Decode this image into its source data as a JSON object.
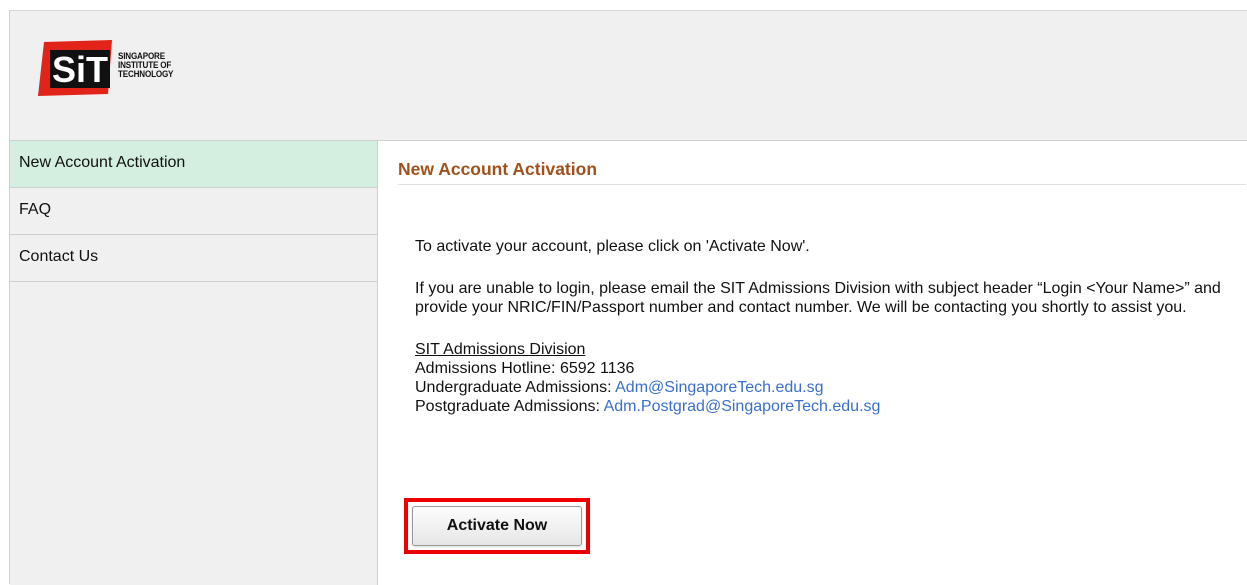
{
  "header": {
    "logo_alt": "SIT Singapore Institute of Technology",
    "logo_mark_text": "SiT",
    "logo_text_lines": [
      "SINGAPORE",
      "INSTITUTE OF",
      "TECHNOLOGY"
    ]
  },
  "sidebar": {
    "items": [
      {
        "label": "New Account Activation",
        "active": true
      },
      {
        "label": "FAQ",
        "active": false
      },
      {
        "label": "Contact Us",
        "active": false
      }
    ]
  },
  "main": {
    "title": "New Account Activation",
    "instruction": "To activate your account, please click on 'Activate Now'.",
    "help_text": "If you are unable to login, please email the SIT Admissions Division with subject header “Login <Your Name>” and provide your NRIC/FIN/Passport number and contact number. We will be contacting you shortly to assist you.",
    "contact": {
      "title": "SIT Admissions Division",
      "hotline_label": "Admissions Hotline: 6592 1136",
      "undergrad_label": "Undergraduate Admissions: ",
      "undergrad_email": "Adm@SingaporeTech.edu.sg",
      "postgrad_label": "Postgraduate Admissions: ",
      "postgrad_email": "Adm.Postgrad@SingaporeTech.edu.sg"
    },
    "activate_button": "Activate Now"
  },
  "colors": {
    "title": "#a0511c",
    "link": "#3a6fcc",
    "active_nav": "#d4eedf",
    "highlight": "#ee0000",
    "logo_red": "#e2231a"
  }
}
